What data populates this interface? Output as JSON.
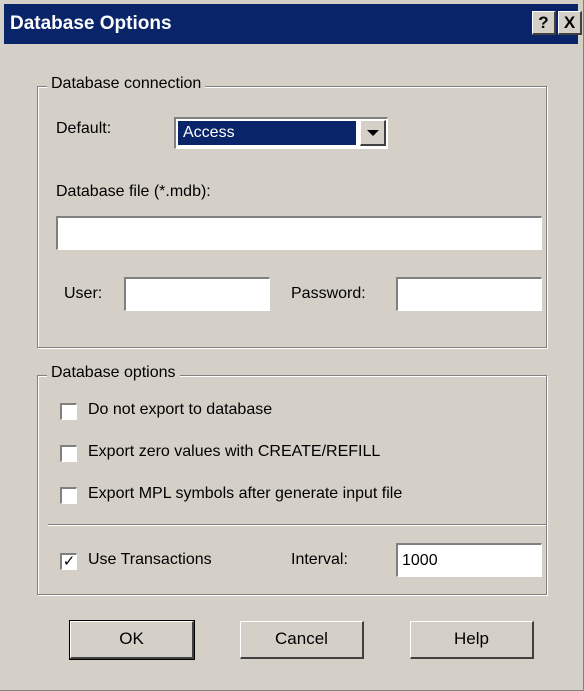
{
  "window": {
    "title": "Database Options",
    "help_glyph": "?",
    "close_glyph": "X"
  },
  "connection": {
    "legend": "Database connection",
    "default_label": "Default:",
    "default_value": "Access",
    "file_label": "Database file (*.mdb):",
    "file_value": "",
    "user_label": "User:",
    "user_value": "",
    "password_label": "Password:",
    "password_value": ""
  },
  "options": {
    "legend": "Database options",
    "checkboxes": [
      {
        "label": "Do not export to database",
        "checked": false
      },
      {
        "label": "Export zero values with CREATE/REFILL",
        "checked": false
      },
      {
        "label": "Export MPL symbols after generate input file",
        "checked": false
      }
    ],
    "transactions": {
      "label": "Use Transactions",
      "checked": true,
      "mark": "✓"
    },
    "interval_label": "Interval:",
    "interval_value": "1000"
  },
  "buttons": {
    "ok": "OK",
    "cancel": "Cancel",
    "help": "Help"
  },
  "colors": {
    "titlebar": "#0a246a",
    "face": "#d4d0c8",
    "selection": "#0a246a"
  }
}
